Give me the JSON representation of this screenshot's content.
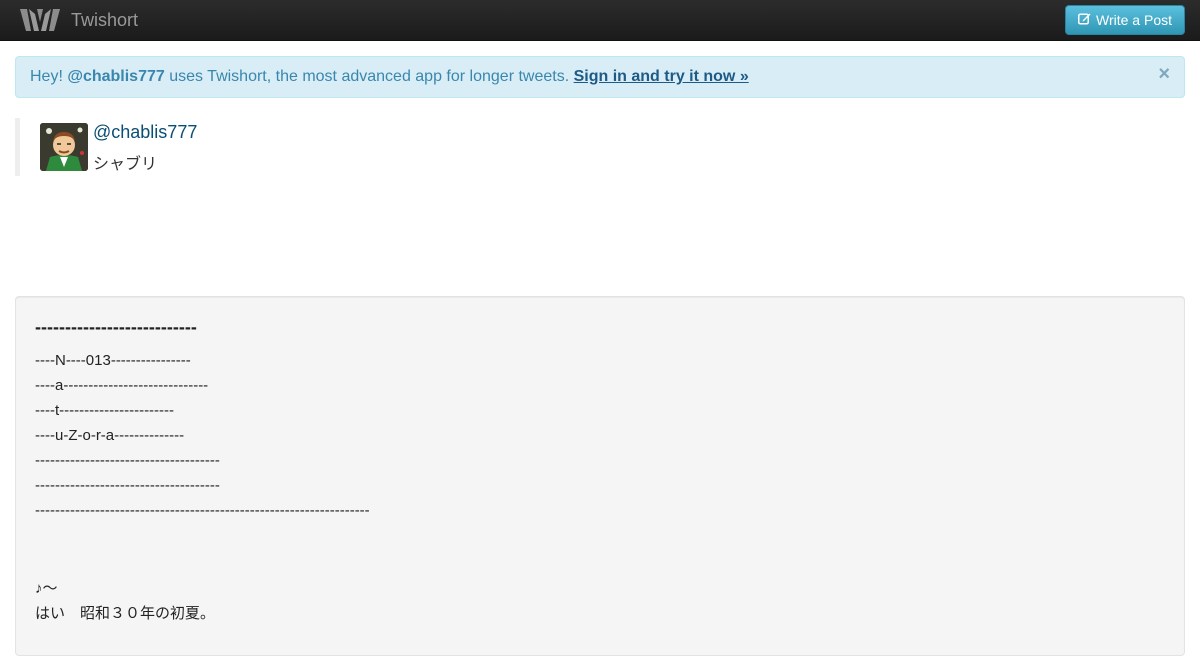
{
  "navbar": {
    "brand": "Twishort",
    "write_button": "Write a Post"
  },
  "alert": {
    "prefix": "Hey! ",
    "user": "@chablis777",
    "message": " uses Twishort, the most advanced app for longer tweets. ",
    "cta": "Sign in and try it now »",
    "close": "×"
  },
  "profile": {
    "handle": "@chablis777",
    "name": "シャブリ"
  },
  "post": {
    "title": "---------------------------",
    "lines": [
      "----N----013----------------",
      "----a-----------------------------",
      "----t-----------------------",
      "----u-Z-o-r-a--------------",
      "-------------------------------------",
      "-------------------------------------",
      "-------------------------------------------------------------------",
      "",
      "",
      "♪～",
      "はい　昭和３０年の初夏。"
    ]
  },
  "colors": {
    "navbar_bg": "#222222",
    "brand_text": "#999999",
    "button_bg": "#49afcd",
    "alert_bg": "#d9edf7",
    "alert_text": "#3a87ad",
    "link": "#0b4d74",
    "well_bg": "#f5f5f5"
  }
}
